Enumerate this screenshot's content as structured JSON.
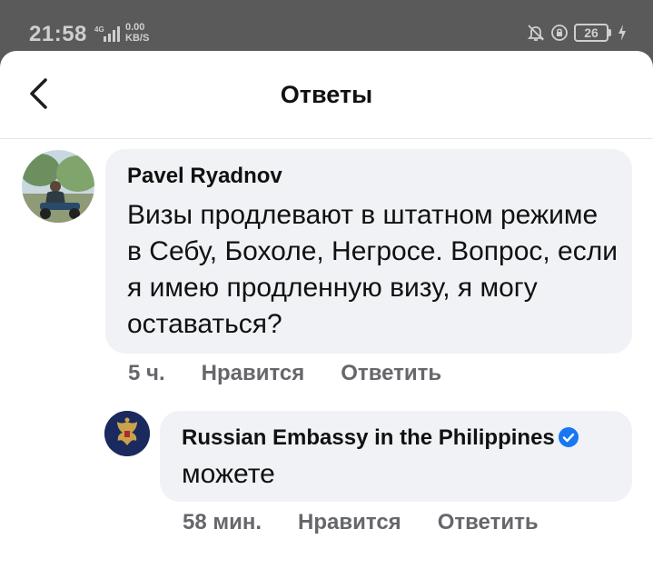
{
  "status_bar": {
    "time": "21:58",
    "network": "4G",
    "speed_value": "0.00",
    "speed_unit": "KB/S",
    "battery": "26"
  },
  "header": {
    "title": "Ответы"
  },
  "comments": [
    {
      "author": "Pavel Ryadnov",
      "text": "Визы продлевают в штатном режиме в Себу, Бохоле, Негросе. Вопрос, если я имею продленную визу, я могу оставаться?",
      "time": "5 ч.",
      "like_label": "Нравится",
      "reply_label": "Ответить"
    },
    {
      "author": "Russian Embassy in the Philippines",
      "verified": true,
      "text": "можете",
      "time": "58 мин.",
      "like_label": "Нравится",
      "reply_label": "Ответить"
    }
  ],
  "colors": {
    "verified_blue": "#1877f2",
    "bubble_bg": "#f0f2f5",
    "meta_gray": "#65676b",
    "embassy_avatar_bg": "#1a2a5e"
  }
}
